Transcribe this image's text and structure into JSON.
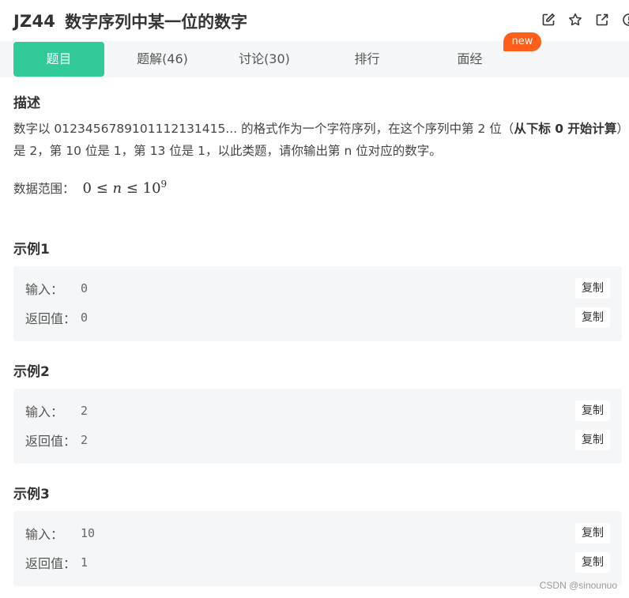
{
  "problem": {
    "id": "JZ44",
    "title": "数字序列中某一位的数字"
  },
  "toolbar": {
    "icons": [
      "edit-icon",
      "star-icon",
      "share-icon",
      "info-icon"
    ]
  },
  "tabs": [
    {
      "label": "题目",
      "active": true
    },
    {
      "label": "题解(46)",
      "active": false
    },
    {
      "label": "讨论(30)",
      "active": false
    },
    {
      "label": "排行",
      "active": false
    },
    {
      "label": "面经",
      "active": false
    }
  ],
  "badge": {
    "label": "new"
  },
  "description": {
    "heading": "描述",
    "text_1": "数字以 0123456789101112131415... 的格式作为一个字符序列，在这个序列中第 2 位（",
    "text_bold": "从下标 0 开始计算",
    "text_2": "）是 2，第 10 位是 1，第 13 位是 1，以此类题，请你输出第 n 位对应的数字。",
    "range_label": "数据范围：",
    "range_math_a": "0 ≤ ",
    "range_math_var": "n",
    "range_math_b": " ≤ 10",
    "range_math_exp": "9"
  },
  "examples": [
    {
      "heading": "示例1",
      "input_label": "输入：",
      "input": "0",
      "output_label": "返回值：",
      "output": "0",
      "copy_label": "复制"
    },
    {
      "heading": "示例2",
      "input_label": "输入：",
      "input": "2",
      "output_label": "返回值：",
      "output": "2",
      "copy_label": "复制"
    },
    {
      "heading": "示例3",
      "input_label": "输入：",
      "input": "10",
      "output_label": "返回值：",
      "output": "1",
      "copy_label": "复制"
    }
  ],
  "watermark": "CSDN @sinounuo",
  "colors": {
    "accent": "#32ca99",
    "badge": "#ff5f1a"
  }
}
